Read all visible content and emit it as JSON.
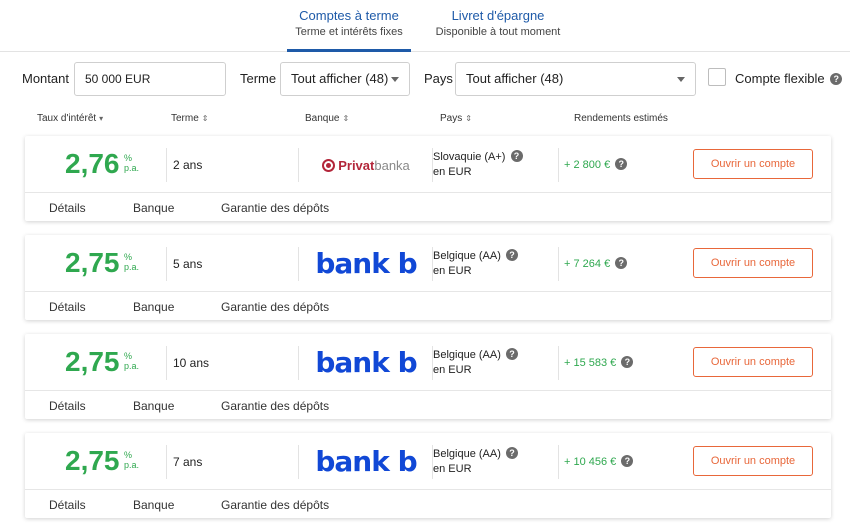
{
  "tabs": [
    {
      "title": "Comptes à terme",
      "subtitle": "Terme et intérêts fixes",
      "active": true
    },
    {
      "title": "Livret d'épargne",
      "subtitle": "Disponible à tout moment",
      "active": false
    }
  ],
  "filters": {
    "amount_label": "Montant",
    "amount_value": "50 000 EUR",
    "term_label": "Terme",
    "term_value": "Tout afficher (48)",
    "country_label": "Pays",
    "country_value": "Tout afficher (48)",
    "flexible_label": "Compte flexible"
  },
  "columns": {
    "rate": "Taux d'intérêt",
    "term": "Terme",
    "bank": "Banque",
    "country": "Pays",
    "yield": "Rendements estimés"
  },
  "offers": [
    {
      "rate": "2,76",
      "unit_pct": "%",
      "unit_pa": "p.a.",
      "term": "2 ans",
      "bank_logo_a": "Privat",
      "bank_logo_b": "banka",
      "country": "Slovaquie (A+)",
      "currency": "en EUR",
      "yield": "+ 2 800 €",
      "button": "Ouvrir un compte"
    },
    {
      "rate": "2,75",
      "unit_pct": "%",
      "unit_pa": "p.a.",
      "term": "5 ans",
      "bank_logo": "bank b",
      "country": "Belgique (AA)",
      "currency": "en EUR",
      "yield": "+ 7 264 €",
      "button": "Ouvrir un compte"
    },
    {
      "rate": "2,75",
      "unit_pct": "%",
      "unit_pa": "p.a.",
      "term": "10 ans",
      "bank_logo": "bank b",
      "country": "Belgique (AA)",
      "currency": "en EUR",
      "yield": "+ 15 583 €",
      "button": "Ouvrir un compte"
    },
    {
      "rate": "2,75",
      "unit_pct": "%",
      "unit_pa": "p.a.",
      "term": "7 ans",
      "bank_logo": "bank b",
      "country": "Belgique (AA)",
      "currency": "en EUR",
      "yield": "+ 10 456 €",
      "button": "Ouvrir un compte"
    }
  ],
  "card_links": {
    "details": "Détails",
    "bank": "Banque",
    "guarantee": "Garantie des dépôts"
  },
  "icons": {
    "help": "?",
    "sort_active": "▾",
    "sort": "⇕"
  },
  "colors": {
    "accent_blue": "#1e5aa8",
    "rate_green": "#2fa84f",
    "button_orange": "#e8673a",
    "bankb_blue": "#1148d6",
    "privat_red": "#b3263a"
  }
}
